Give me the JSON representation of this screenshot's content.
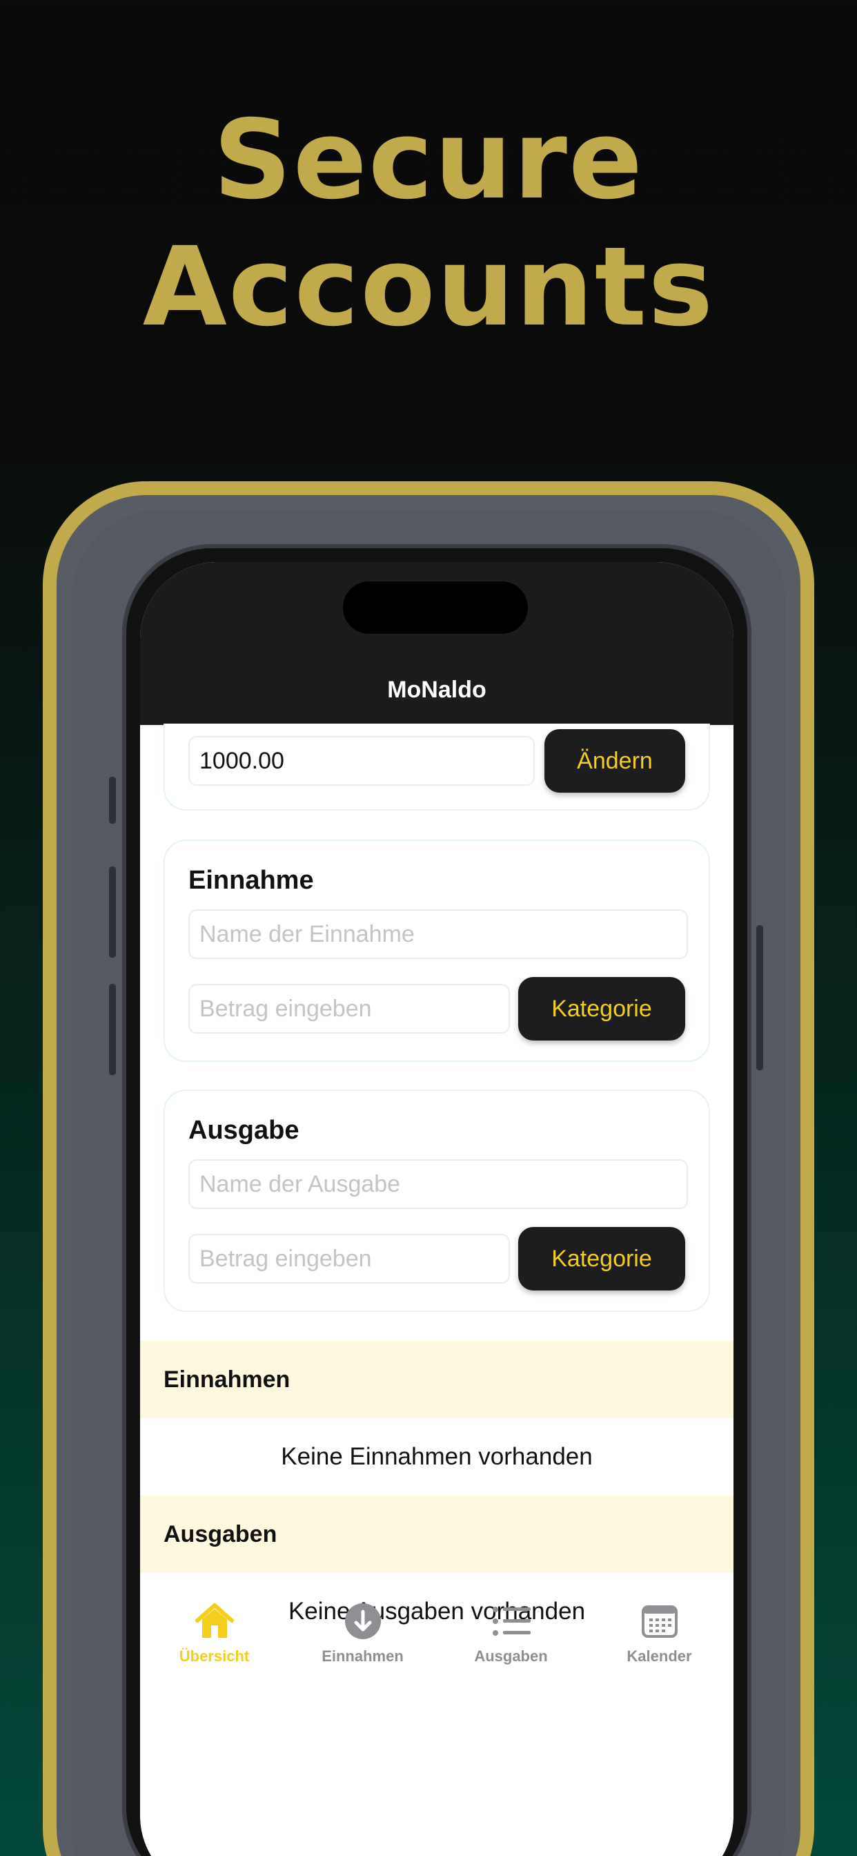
{
  "headline": {
    "line1": "Secure",
    "line2": "Accounts"
  },
  "app": {
    "title": "MoNaldo"
  },
  "balance": {
    "value": "1000.00",
    "button": "Ändern"
  },
  "income_card": {
    "title": "Einnahme",
    "name_placeholder": "Name der Einnahme",
    "amount_placeholder": "Betrag eingeben",
    "category_button": "Kategorie"
  },
  "expense_card": {
    "title": "Ausgabe",
    "name_placeholder": "Name der Ausgabe",
    "amount_placeholder": "Betrag eingeben",
    "category_button": "Kategorie"
  },
  "income_list": {
    "header": "Einnahmen",
    "empty": "Keine Einnahmen vorhanden"
  },
  "expense_list": {
    "header": "Ausgaben",
    "empty": "Keine Ausgaben vorhanden"
  },
  "tabs": [
    {
      "label": "Übersicht",
      "icon": "house-icon",
      "active": true
    },
    {
      "label": "Einnahmen",
      "icon": "arrow-down-circle-icon",
      "active": false
    },
    {
      "label": "Ausgaben",
      "icon": "list-icon",
      "active": false
    },
    {
      "label": "Kalender",
      "icon": "calendar-icon",
      "active": false
    }
  ],
  "colors": {
    "accent_gold": "#c2a94b",
    "button_text_yellow": "#f4cd1d",
    "dark_button": "#1d1d1f",
    "section_header_bg": "#fef9de",
    "tab_inactive": "#8e8e93"
  }
}
